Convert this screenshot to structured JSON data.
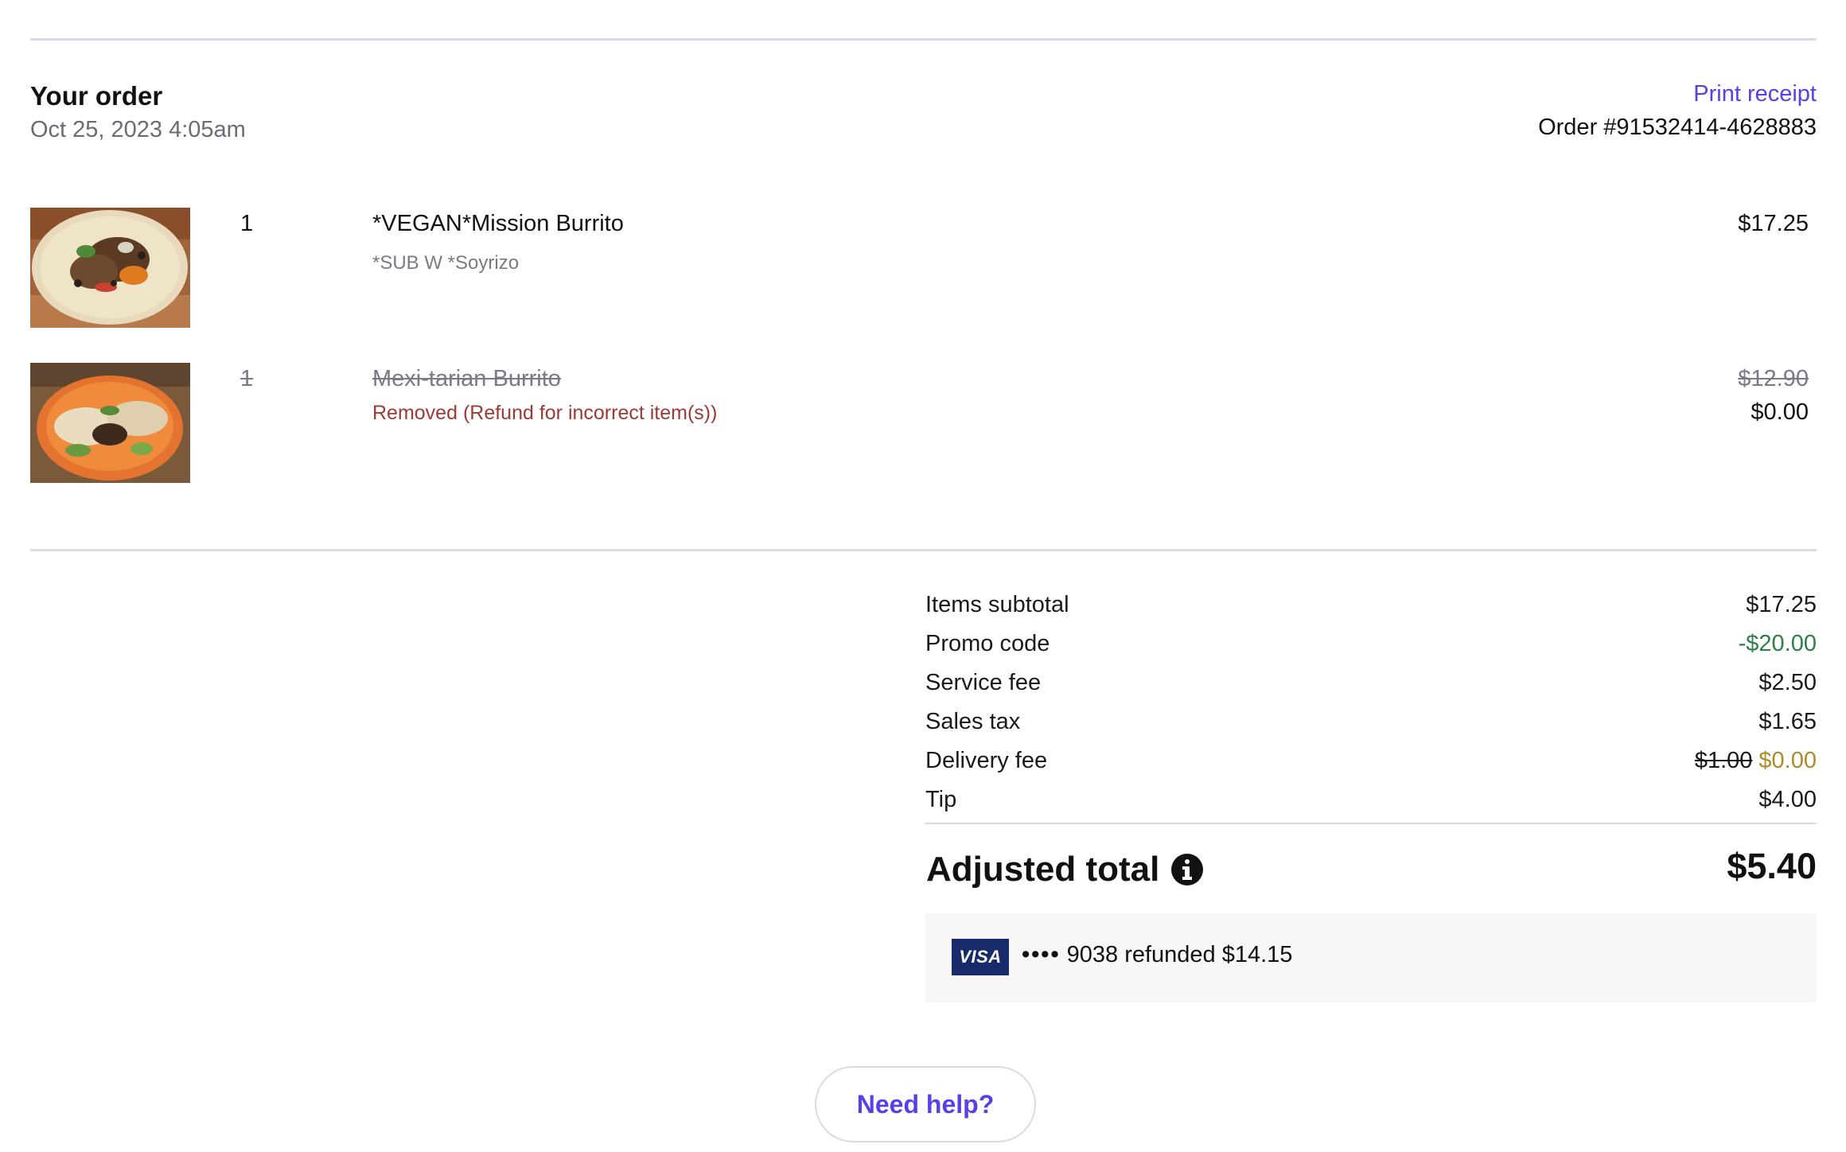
{
  "order": {
    "title": "Your order",
    "date": "Oct 25, 2023 4:05am",
    "print_receipt": "Print receipt",
    "order_number": "Order #91532414-4628883"
  },
  "items": [
    {
      "quantity": "1",
      "name": "*VEGAN*Mission Burrito",
      "modifier": "*SUB W *Soyrizo",
      "price": "$17.25"
    },
    {
      "quantity": "1",
      "name": "Mexi-tarian Burrito",
      "status": "Removed (Refund for incorrect item(s))",
      "original_price": "$12.90",
      "price": "$0.00"
    }
  ],
  "summary": {
    "items_subtotal_label": "Items subtotal",
    "items_subtotal": "$17.25",
    "promo_label": "Promo code",
    "promo": "-$20.00",
    "service_fee_label": "Service fee",
    "service_fee": "$2.50",
    "sales_tax_label": "Sales tax",
    "sales_tax": "$1.65",
    "delivery_fee_label": "Delivery fee",
    "delivery_fee_original": "$1.00",
    "delivery_fee": "$0.00",
    "tip_label": "Tip",
    "tip": "$4.00",
    "total_label": "Adjusted total",
    "total": "$5.40"
  },
  "payment": {
    "card_brand": "VISA",
    "masked": "••••",
    "text": "9038 refunded $14.15"
  },
  "help_button": "Need help?",
  "colors": {
    "accent": "#5b3ee8",
    "promo_green": "#2f7d48",
    "delivery_gold": "#b08a2a",
    "removed_red": "#9a3b36",
    "visa_blue": "#172b6b"
  },
  "icons": {
    "info": "info-circle-icon"
  }
}
